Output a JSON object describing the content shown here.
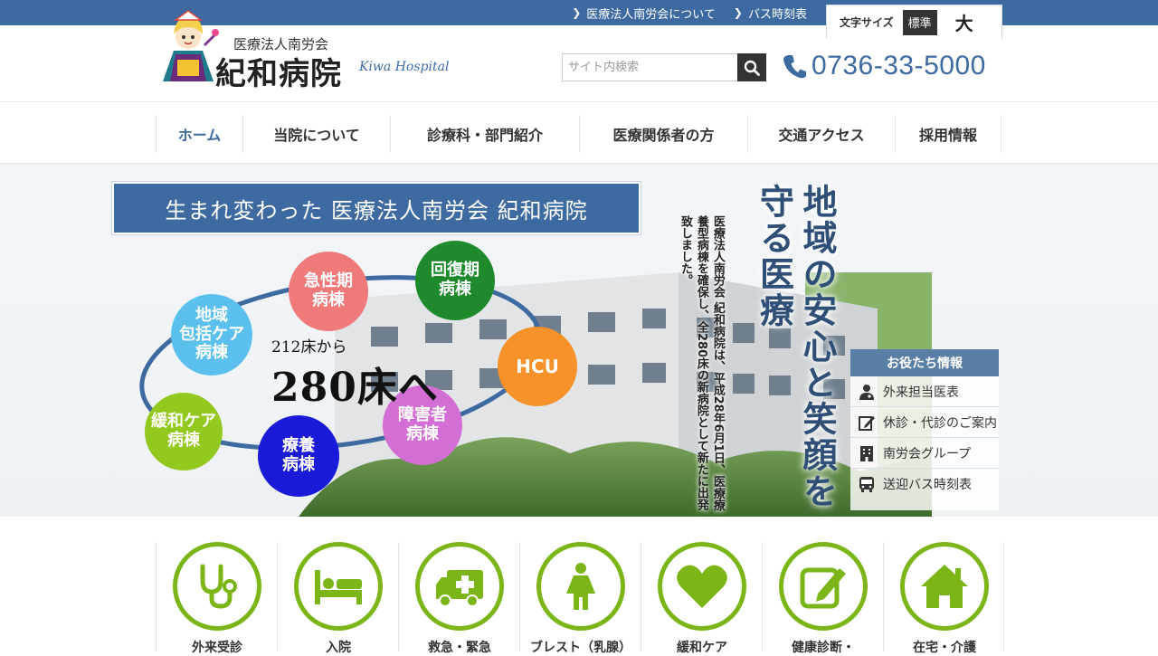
{
  "topbar": {
    "links": [
      {
        "label": "医療法人南労会について"
      },
      {
        "label": "バス時刻表"
      }
    ],
    "font_size": {
      "label": "文字サイズ",
      "standard": "標準",
      "large": "大"
    }
  },
  "header": {
    "logo_sub": "医療法人南労会",
    "logo_main": "紀和病院",
    "logo_en": "Kiwa Hospital",
    "search_placeholder": "サイト内検索",
    "phone": "0736-33-5000"
  },
  "nav": {
    "items": [
      {
        "label": "ホーム",
        "active": true
      },
      {
        "label": "当院について"
      },
      {
        "label": "診療科・部門紹介"
      },
      {
        "label": "医療関係者の方"
      },
      {
        "label": "交通アクセス"
      },
      {
        "label": "採用情報"
      }
    ]
  },
  "hero": {
    "banner": "生まれ変わった 医療法人南労会 紀和病院",
    "beds_from": "212床から",
    "beds_to": "280床へ",
    "slogan": "地域の安心と笑顔を守る医療",
    "intro": "医療法人南労会 紀和病院は、平成28年6月1日、医療療養型病棟を確保し、全280床の新病院として新たに出発致しました。",
    "wards": [
      {
        "label": "急性期\n病棟",
        "color": "#f0797a"
      },
      {
        "label": "回復期\n病棟",
        "color": "#1f8a2c"
      },
      {
        "label": "HCU",
        "color": "#f7922a"
      },
      {
        "label": "障害者\n病棟",
        "color": "#d36fd4"
      },
      {
        "label": "療養\n病棟",
        "color": "#1a1bd9"
      },
      {
        "label": "緩和ケア\n病棟",
        "color": "#93c81f"
      },
      {
        "label": "地域\n包括ケア\n病棟",
        "color": "#5bc0ee"
      }
    ]
  },
  "useful": {
    "title": "お役たち情報",
    "items": [
      {
        "label": "外来担当医表",
        "icon": "doctor-icon"
      },
      {
        "label": "休診・代診のご案内",
        "icon": "edit-icon"
      },
      {
        "label": "南労会グループ",
        "icon": "building-icon"
      },
      {
        "label": "送迎バス時刻表",
        "icon": "bus-icon"
      }
    ]
  },
  "services": [
    {
      "label": "外来受診",
      "icon": "stethoscope-icon"
    },
    {
      "label": "入院",
      "icon": "bed-icon"
    },
    {
      "label": "救急・緊急",
      "icon": "ambulance-icon"
    },
    {
      "label": "ブレスト（乳腺）",
      "icon": "woman-icon"
    },
    {
      "label": "緩和ケア",
      "icon": "heart-icon"
    },
    {
      "label": "健康診断・",
      "icon": "checkup-icon"
    },
    {
      "label": "在宅・介護",
      "icon": "home-icon"
    }
  ],
  "colors": {
    "brand_blue": "#3d6aa0",
    "accent_green": "#7cb518"
  }
}
